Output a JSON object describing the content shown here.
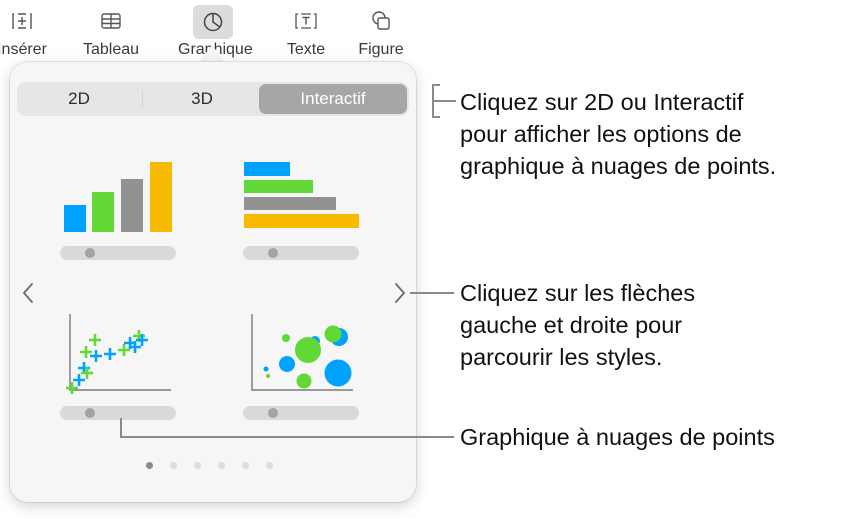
{
  "toolbar": {
    "items": [
      {
        "label": "Insérer",
        "icon": "insert-icon"
      },
      {
        "label": "Tableau",
        "icon": "table-icon"
      },
      {
        "label": "Graphique",
        "icon": "chart-icon",
        "active": true
      },
      {
        "label": "Texte",
        "icon": "text-icon"
      },
      {
        "label": "Figure",
        "icon": "shape-icon"
      }
    ]
  },
  "popover": {
    "segments": [
      {
        "label": "2D"
      },
      {
        "label": "3D"
      },
      {
        "label": "Interactif",
        "selected": true
      }
    ],
    "chart_styles": [
      {
        "name": "column-chart",
        "slider_value": 0.15
      },
      {
        "name": "bar-chart",
        "slider_value": 0.15
      },
      {
        "name": "scatter-chart",
        "slider_value": 0.15
      },
      {
        "name": "bubble-chart",
        "slider_value": 0.15
      }
    ],
    "colors": {
      "blue": "#00a2ff",
      "green": "#61d836",
      "gray": "#929292",
      "yellow": "#f8ba00"
    },
    "page_count": 6,
    "current_page": 1
  },
  "callouts": {
    "segments": [
      "Cliquez sur 2D ou Interactif",
      "pour afficher les options de",
      "graphique à nuages de points."
    ],
    "arrows": [
      "Cliquez sur les flèches",
      "gauche et droite pour",
      "parcourir les styles."
    ],
    "scatter": [
      "Graphique à nuages de points"
    ]
  }
}
